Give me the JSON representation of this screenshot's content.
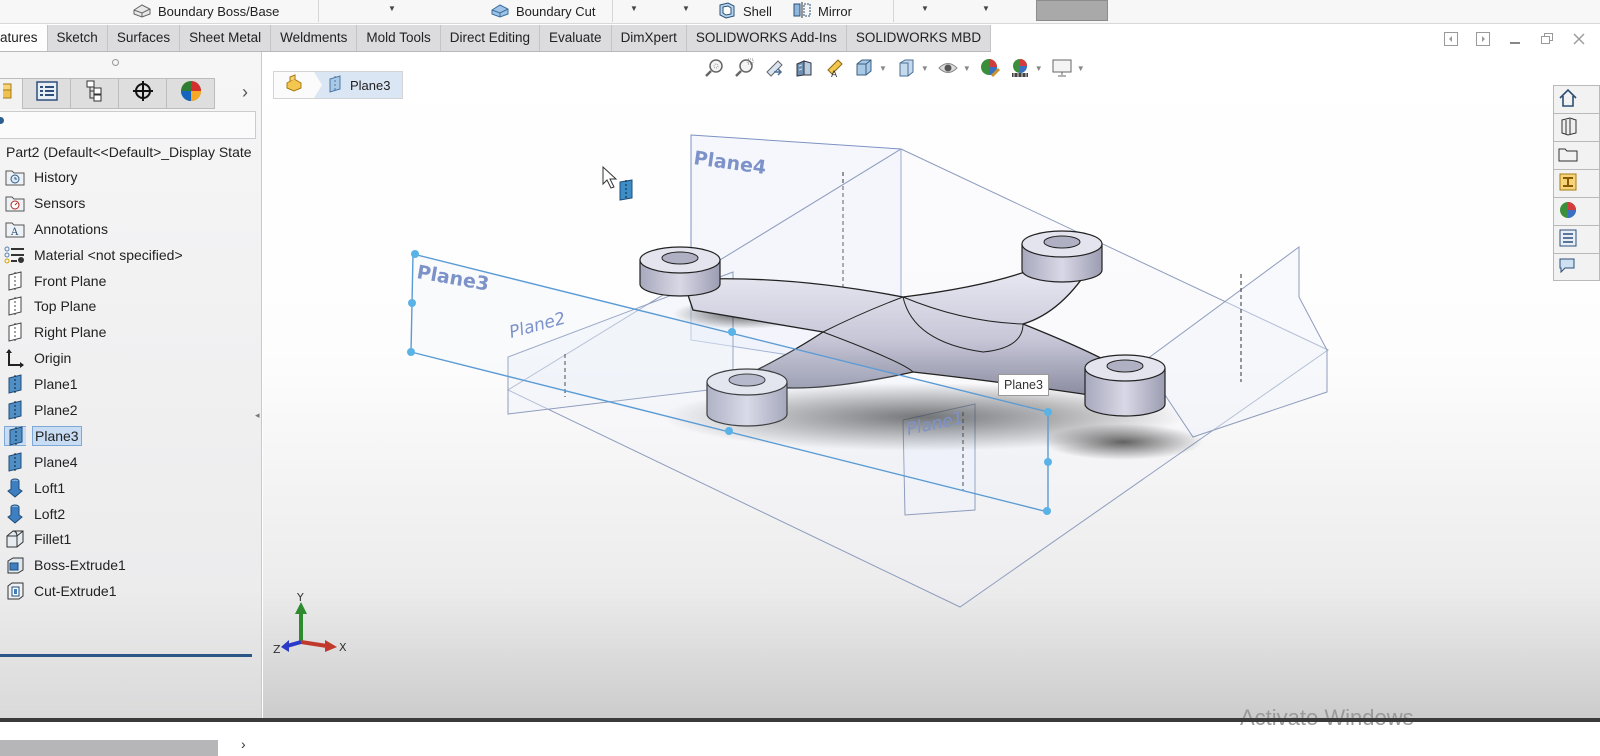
{
  "ribbon": {
    "items": [
      {
        "label": "Boundary Boss/Base",
        "icon": "boundary-boss-icon"
      },
      {
        "label": "Boundary Cut",
        "icon": "boundary-cut-icon"
      },
      {
        "label": "Shell",
        "icon": "shell-icon"
      },
      {
        "label": "Mirror",
        "icon": "mirror-icon"
      }
    ]
  },
  "tabs": [
    {
      "label": "atures",
      "active": true
    },
    {
      "label": "Sketch"
    },
    {
      "label": "Surfaces"
    },
    {
      "label": "Sheet Metal"
    },
    {
      "label": "Weldments"
    },
    {
      "label": "Mold Tools"
    },
    {
      "label": "Direct Editing"
    },
    {
      "label": "Evaluate"
    },
    {
      "label": "DimXpert"
    },
    {
      "label": "SOLIDWORKS Add-Ins"
    },
    {
      "label": "SOLIDWORKS MBD"
    }
  ],
  "window_controls": [
    "tile-left-icon",
    "tile-right-icon",
    "minimize-icon",
    "restore-icon",
    "close-icon"
  ],
  "feature_manager": {
    "panel_tabs": [
      "featuremanager-tree-icon",
      "propertymanager-icon",
      "configurationmanager-icon",
      "dimxpert-manager-icon",
      "display-manager-icon"
    ],
    "root": "Part2  (Default<<Default>_Display State",
    "nodes": [
      {
        "label": "History",
        "icon": "history-folder-icon"
      },
      {
        "label": "Sensors",
        "icon": "sensors-folder-icon"
      },
      {
        "label": "Annotations",
        "icon": "annotations-folder-icon"
      },
      {
        "label": "Material <not specified>",
        "icon": "material-icon"
      },
      {
        "label": "Front Plane",
        "icon": "plane-icon"
      },
      {
        "label": "Top Plane",
        "icon": "plane-icon"
      },
      {
        "label": "Right Plane",
        "icon": "plane-icon"
      },
      {
        "label": "Origin",
        "icon": "origin-icon"
      },
      {
        "label": "Plane1",
        "icon": "ref-plane-icon"
      },
      {
        "label": "Plane2",
        "icon": "ref-plane-icon"
      },
      {
        "label": "Plane3",
        "icon": "ref-plane-icon",
        "selected": true
      },
      {
        "label": "Plane4",
        "icon": "ref-plane-icon"
      },
      {
        "label": "Loft1",
        "icon": "loft-icon"
      },
      {
        "label": "Loft2",
        "icon": "loft-icon"
      },
      {
        "label": "Fillet1",
        "icon": "fillet-icon"
      },
      {
        "label": "Boss-Extrude1",
        "icon": "boss-extrude-icon"
      },
      {
        "label": "Cut-Extrude1",
        "icon": "cut-extrude-icon"
      }
    ]
  },
  "breadcrumb": {
    "selected": "Plane3"
  },
  "heads_up_toolbar": [
    "zoom-to-fit-icon",
    "zoom-to-area-icon",
    "previous-view-icon",
    "section-view-icon",
    "dynamic-annotation-icon",
    "view-orientation-icon",
    "display-style-icon",
    "hide-show-icon",
    "edit-appearance-icon",
    "apply-scene-icon",
    "view-settings-icon"
  ],
  "task_pane": [
    "home-icon",
    "design-library-icon",
    "file-explorer-icon",
    "view-palette-icon",
    "appearances-icon",
    "custom-properties-icon",
    "forum-icon"
  ],
  "viewport": {
    "plane_labels": [
      "Plane4",
      "Plane3",
      "Plane2",
      "Plane1"
    ],
    "tooltip": "Plane3",
    "triad": {
      "x": "X",
      "y": "Y",
      "z": "Z"
    }
  },
  "watermark": "Activate Windows"
}
